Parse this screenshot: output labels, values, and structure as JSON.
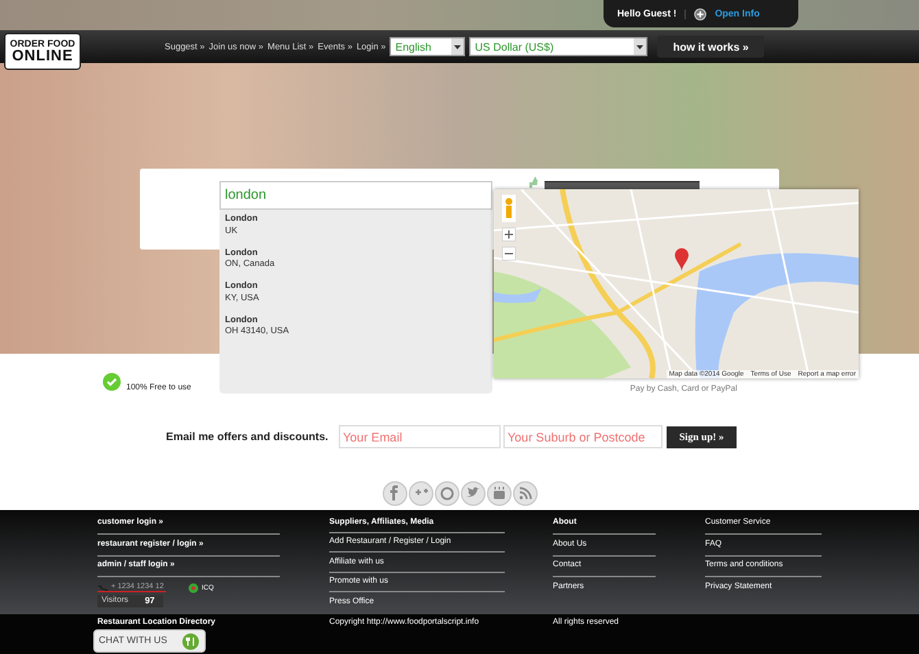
{
  "header": {
    "greeting": "Hello Guest !",
    "info_link": "Open Info"
  },
  "logo": {
    "line_1": "ORDER FOOD",
    "line_2": "ONLINE"
  },
  "nav": {
    "links": [
      "Suggest »",
      "Join us now »",
      "Menu List »",
      "Events »",
      "Login »"
    ],
    "language": "English",
    "currency": "US Dollar (US$)",
    "how_it_works": "how it works »"
  },
  "search": {
    "value": "london",
    "suggestions": [
      {
        "name": "London",
        "region": "UK"
      },
      {
        "name": "London",
        "region": "ON, Canada"
      },
      {
        "name": "London",
        "region": "KY, USA"
      },
      {
        "name": "London",
        "region": "OH 43140, USA"
      }
    ]
  },
  "map": {
    "attribution": "Map data ©2014 Google",
    "terms": "Terms of Use",
    "report": "Report a map error"
  },
  "features": [
    "100% Free to use",
    "Pay by Cash, Card or PayPal"
  ],
  "newsletter": {
    "label": "Email me offers and discounts.",
    "email_placeholder": "Your Email",
    "suburb_placeholder": "Your Suburb or Postcode",
    "button": "Sign up! »"
  },
  "footer": {
    "columns": [
      {
        "items": [
          {
            "text": "customer login »",
            "bold": true
          },
          {
            "text": "restaurant register / login »",
            "bold": true
          },
          {
            "text": "admin / staff login »",
            "bold": true
          }
        ]
      },
      {
        "items": [
          {
            "text": "Suppliers, Affiliates, Media",
            "bold": true
          },
          {
            "text": "Add Restaurant / Register / Login",
            "bold": false
          },
          {
            "text": "Affiliate with us",
            "bold": false
          },
          {
            "text": "Promote with us",
            "bold": false
          },
          {
            "text": "Press Office",
            "bold": false
          }
        ]
      },
      {
        "items": [
          {
            "text": "About",
            "bold": true
          },
          {
            "text": "About Us",
            "bold": false
          },
          {
            "text": "Contact",
            "bold": false
          },
          {
            "text": "Partners",
            "bold": false
          }
        ]
      },
      {
        "items": [
          {
            "text": "Customer Service",
            "bold": false
          },
          {
            "text": "FAQ",
            "bold": false
          },
          {
            "text": "Terms and conditions",
            "bold": false
          },
          {
            "text": "Privacy Statement",
            "bold": false
          }
        ]
      }
    ],
    "contact": {
      "phone": "+ 1234 1234 12",
      "icq": "ICQ",
      "visitors_label": "Visitors",
      "visitors_count": "97"
    },
    "bottom": [
      "Restaurant Location Directory",
      "Copyright http://www.foodportalscript.info",
      "All rights reserved"
    ]
  },
  "chat": {
    "label": "CHAT WITH US"
  }
}
